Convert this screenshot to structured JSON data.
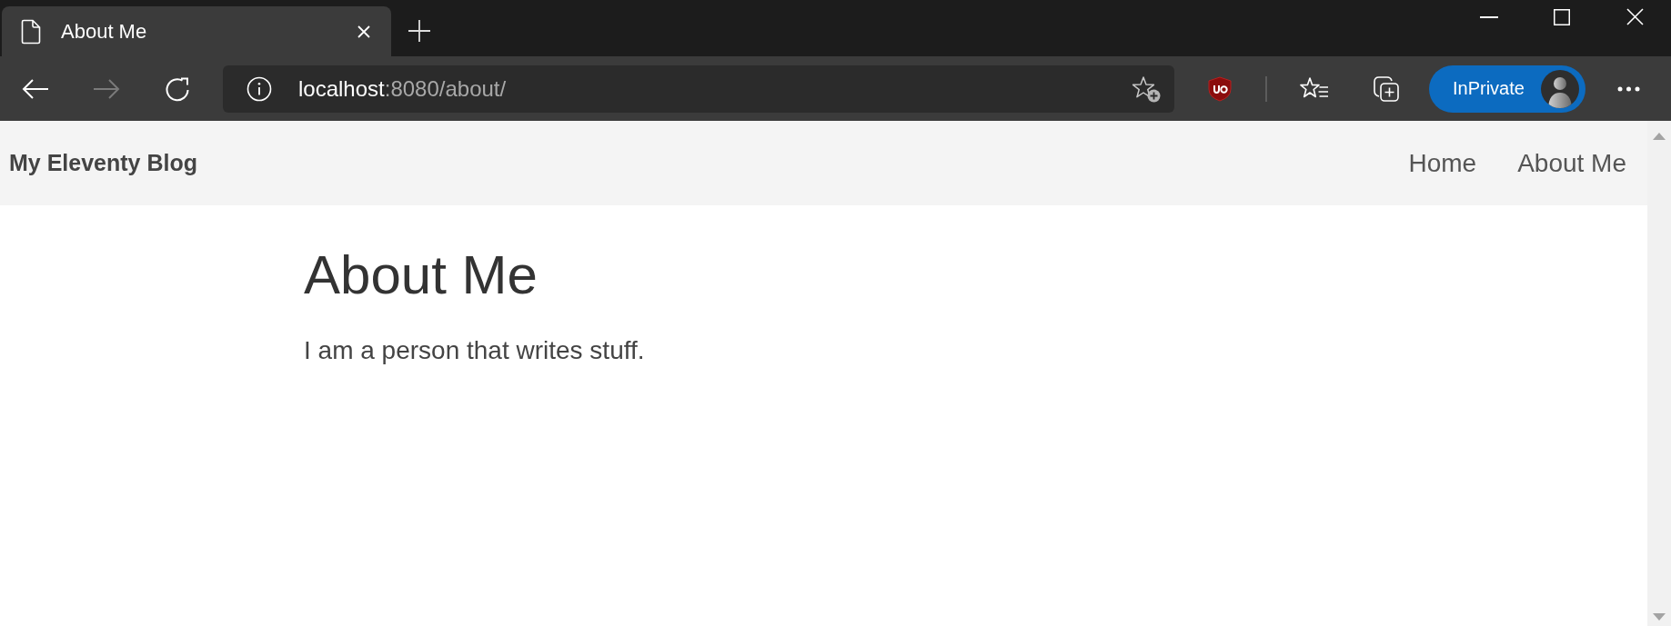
{
  "tabs": [
    {
      "title": "About Me",
      "selected": true
    }
  ],
  "toolbar": {
    "buttons": [
      {
        "kind": "back",
        "disabled": false
      },
      {
        "kind": "forward",
        "disabled": true
      },
      {
        "kind": "refresh",
        "disabled": false
      }
    ],
    "address_bar": {
      "host": "localhost",
      "path": ":8080/about/"
    },
    "profile_button": {
      "label": "InPrivate"
    }
  },
  "site_header": {
    "title": "My Eleventy Blog",
    "nav_links": [
      {
        "label": "Home"
      },
      {
        "label": "About Me"
      }
    ]
  },
  "page": {
    "heading": "About Me",
    "paragraph": "I am a person that writes stuff."
  }
}
